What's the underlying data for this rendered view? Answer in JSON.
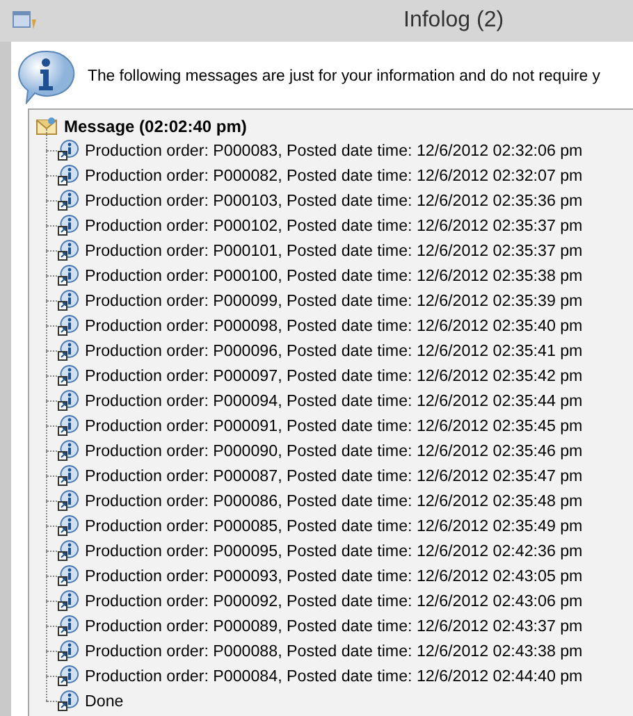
{
  "window": {
    "title": "Infolog (2)"
  },
  "intro": "The following messages are just for your information and do not require y",
  "tree": [
    {
      "label": "Message (02:02:40 pm)",
      "children": [
        {
          "label": "Production order: P000083, Posted date time: 12/6/2012 02:32:06 pm"
        },
        {
          "label": "Production order: P000082, Posted date time: 12/6/2012 02:32:07 pm"
        },
        {
          "label": "Production order: P000103, Posted date time: 12/6/2012 02:35:36 pm"
        },
        {
          "label": "Production order: P000102, Posted date time: 12/6/2012 02:35:37 pm"
        },
        {
          "label": "Production order: P000101, Posted date time: 12/6/2012 02:35:37 pm"
        },
        {
          "label": "Production order: P000100, Posted date time: 12/6/2012 02:35:38 pm"
        },
        {
          "label": "Production order: P000099, Posted date time: 12/6/2012 02:35:39 pm"
        },
        {
          "label": "Production order: P000098, Posted date time: 12/6/2012 02:35:40 pm"
        },
        {
          "label": "Production order: P000096, Posted date time: 12/6/2012 02:35:41 pm"
        },
        {
          "label": "Production order: P000097, Posted date time: 12/6/2012 02:35:42 pm"
        },
        {
          "label": "Production order: P000094, Posted date time: 12/6/2012 02:35:44 pm"
        },
        {
          "label": "Production order: P000091, Posted date time: 12/6/2012 02:35:45 pm"
        },
        {
          "label": "Production order: P000090, Posted date time: 12/6/2012 02:35:46 pm"
        },
        {
          "label": "Production order: P000087, Posted date time: 12/6/2012 02:35:47 pm"
        },
        {
          "label": "Production order: P000086, Posted date time: 12/6/2012 02:35:48 pm"
        },
        {
          "label": "Production order: P000085, Posted date time: 12/6/2012 02:35:49 pm"
        },
        {
          "label": "Production order: P000095, Posted date time: 12/6/2012 02:42:36 pm"
        },
        {
          "label": "Production order: P000093, Posted date time: 12/6/2012 02:43:05 pm"
        },
        {
          "label": "Production order: P000092, Posted date time: 12/6/2012 02:43:06 pm"
        },
        {
          "label": "Production order: P000089, Posted date time: 12/6/2012 02:43:37 pm"
        },
        {
          "label": "Production order: P000088, Posted date time: 12/6/2012 02:43:38 pm"
        },
        {
          "label": "Production order: P000084, Posted date time: 12/6/2012 02:44:40 pm"
        },
        {
          "label": "Done"
        }
      ]
    }
  ]
}
